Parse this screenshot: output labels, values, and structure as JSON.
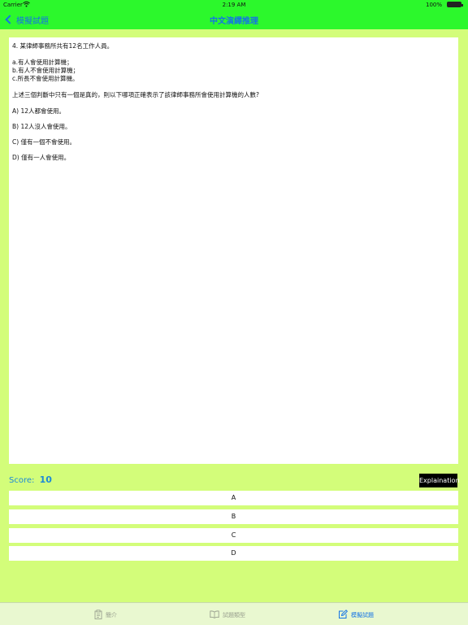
{
  "status_bar": {
    "carrier": "Carrier",
    "time": "2:19 AM",
    "battery": "100%",
    "wifi_icon": "wifi-icon",
    "battery_icon": "battery-icon"
  },
  "nav": {
    "back_label": "模擬試題",
    "title": "中文演繹推理"
  },
  "question": {
    "title": "4. 某律師事務所共有12名工作人員。",
    "conditions": [
      "a.有人會使用計算機；",
      "b.有人不會使用計算機；",
      "c.所長不會使用計算機。"
    ],
    "prompt": "上述三個判斷中只有一個是真的，則以下哪項正確表示了該律師事務所會使用計算機的人數?",
    "options": [
      "A) 12人都會使用。",
      "B) 12人沒人會使用。",
      "C) 僅有一個不會使用。",
      "D) 僅有一人會使用。"
    ]
  },
  "score": {
    "label": "Score:",
    "value": "10"
  },
  "explanation_label": "Explaination",
  "answers": [
    "A",
    "B",
    "C",
    "D"
  ],
  "tabs": [
    {
      "label": "簡介",
      "icon": "clipboard-icon",
      "active": false
    },
    {
      "label": "試題類型",
      "icon": "book-icon",
      "active": false
    },
    {
      "label": "模擬試題",
      "icon": "edit-icon",
      "active": true
    }
  ],
  "colors": {
    "nav_bg": "#2cf82c",
    "page_bg": "#d3fd7a",
    "accent": "#1473e6",
    "tab_inactive": "#9aa08f"
  }
}
